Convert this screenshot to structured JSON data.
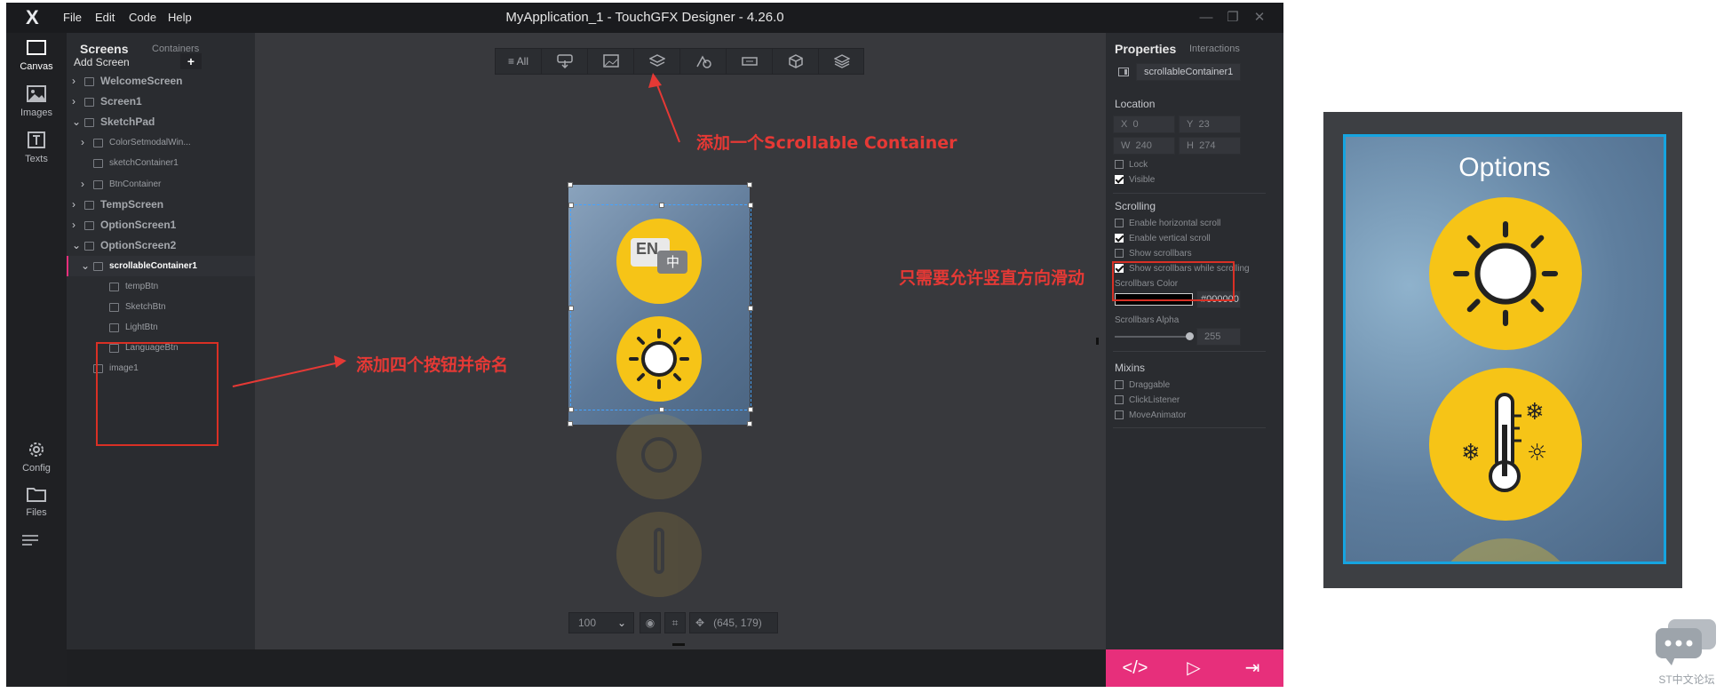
{
  "window": {
    "logo": "X",
    "menu": [
      "File",
      "Edit",
      "Code",
      "Help"
    ],
    "title": "MyApplication_1 - TouchGFX Designer - 4.26.0",
    "controls": [
      "—",
      "❐",
      "✕"
    ]
  },
  "leftbar": {
    "items": [
      {
        "label": "Canvas",
        "icon": "canvas-icon",
        "active": true
      },
      {
        "label": "Images",
        "icon": "image-icon",
        "active": false
      },
      {
        "label": "Texts",
        "icon": "text-icon",
        "active": false
      },
      {
        "label": "Config",
        "icon": "gear-icon",
        "active": false
      },
      {
        "label": "Files",
        "icon": "folder-icon",
        "active": false
      }
    ],
    "menu_icon": "hamburger-icon"
  },
  "screens_panel": {
    "tab_active": "Screens",
    "tab_inactive": "Containers",
    "add_screen": "Add Screen",
    "add_icon": "+",
    "tree": [
      {
        "label": "WelcomeScreen",
        "level": 0,
        "chev": "›",
        "bold": true
      },
      {
        "label": "Screen1",
        "level": 0,
        "chev": "›",
        "bold": true
      },
      {
        "label": "SketchPad",
        "level": 0,
        "chev": "⌄",
        "bold": true
      },
      {
        "label": "ColorSetmodalWin...",
        "level": 1,
        "chev": "›",
        "bold": false
      },
      {
        "label": "sketchContainer1",
        "level": 1,
        "chev": "",
        "bold": false
      },
      {
        "label": "BtnContainer",
        "level": 1,
        "chev": "›",
        "bold": false
      },
      {
        "label": "TempScreen",
        "level": 0,
        "chev": "›",
        "bold": true
      },
      {
        "label": "OptionScreen1",
        "level": 0,
        "chev": "›",
        "bold": true
      },
      {
        "label": "OptionScreen2",
        "level": 0,
        "chev": "⌄",
        "bold": true
      },
      {
        "label": "scrollableContainer1",
        "level": 1,
        "chev": "⌄",
        "bold": true,
        "selected": true
      },
      {
        "label": "tempBtn",
        "level": 2,
        "chev": "",
        "bold": false
      },
      {
        "label": "SketchBtn",
        "level": 2,
        "chev": "",
        "bold": false
      },
      {
        "label": "LightBtn",
        "level": 2,
        "chev": "",
        "bold": false
      },
      {
        "label": "LanguageBtn",
        "level": 2,
        "chev": "",
        "bold": false
      },
      {
        "label": "image1",
        "level": 1,
        "chev": "",
        "bold": false
      }
    ]
  },
  "toolbar": {
    "all_label": "≡ All",
    "icons": [
      "button-icon",
      "image-icon",
      "container-icon",
      "shapes-icon",
      "text-area-icon",
      "3d-icon",
      "layers-icon"
    ]
  },
  "annotations": {
    "add_container": "添加一个Scrollable Container",
    "add_buttons": "添加四个按钮并命名",
    "vertical_only": "只需要允许竖直方向滑动"
  },
  "canvas": {
    "lang_en": "EN",
    "lang_zh": "中",
    "zoom": "100",
    "coords": "(645, 179)"
  },
  "properties": {
    "tab_active": "Properties",
    "tab_inactive": "Interactions",
    "name": "scrollableContainer1",
    "location_header": "Location",
    "x_label": "X",
    "x_value": "0",
    "y_label": "Y",
    "y_value": "23",
    "w_label": "W",
    "w_value": "240",
    "h_label": "H",
    "h_value": "274",
    "lock": "Lock",
    "visible": "Visible",
    "scrolling_header": "Scrolling",
    "enable_h": "Enable horizontal scroll",
    "enable_v": "Enable vertical scroll",
    "show_sb": "Show scrollbars",
    "show_sb_scroll": "Show scrollbars while scrolling",
    "sb_color_label": "Scrollbars Color",
    "sb_color_value": "#000000",
    "sb_alpha_label": "Scrollbars Alpha",
    "sb_alpha_value": "255",
    "mixins_header": "Mixins",
    "draggable": "Draggable",
    "click_listener": "ClickListener",
    "move_animator": "MoveAnimator"
  },
  "action_bar": {
    "icons": [
      "code-icon",
      "run-icon",
      "export-icon"
    ],
    "glyphs": [
      "</>",
      "▷",
      "⇥"
    ]
  },
  "preview": {
    "title": "Options"
  },
  "watermark": {
    "text": "ST中文论坛"
  },
  "colors": {
    "accent_pink": "#e72f7b",
    "selection_blue": "#16a4e0",
    "annotation_red": "#e53935",
    "button_yellow": "#f6c417"
  }
}
